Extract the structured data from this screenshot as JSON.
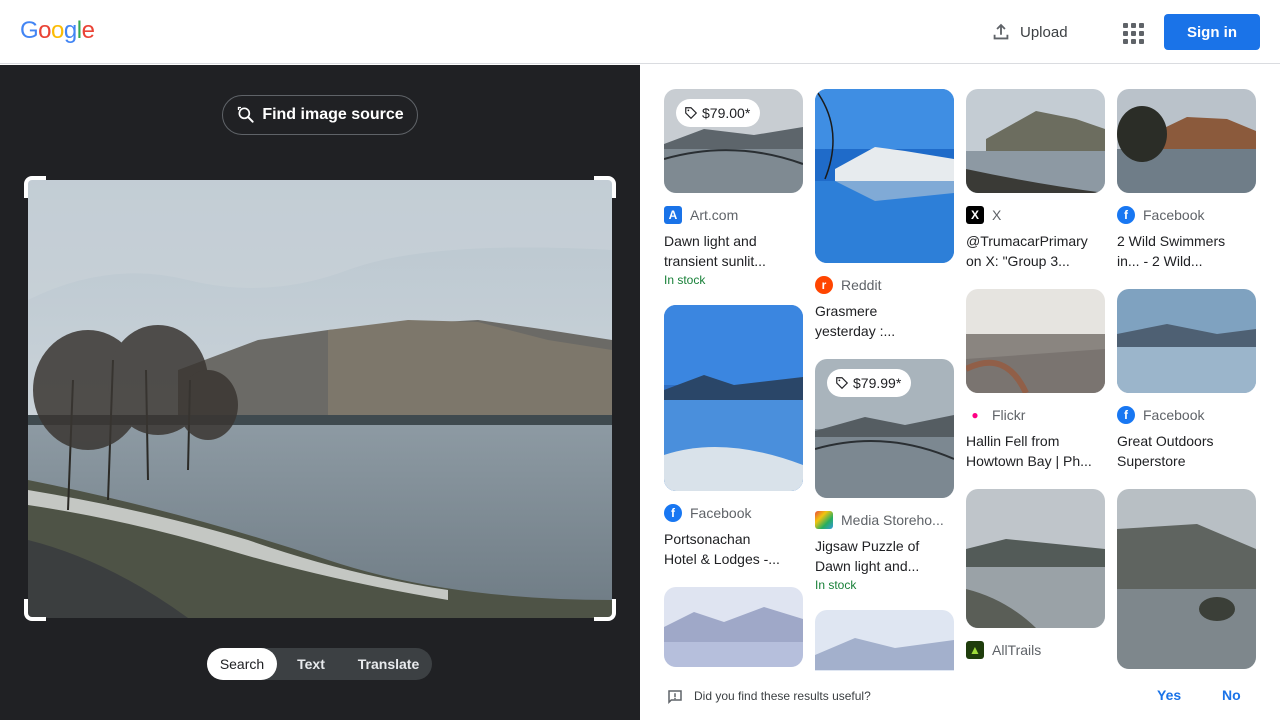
{
  "header": {
    "logo_letters": [
      "G",
      "o",
      "o",
      "g",
      "l",
      "e"
    ],
    "upload_label": "Upload",
    "sign_in_label": "Sign in"
  },
  "left": {
    "find_source_label": "Find image source",
    "modes": [
      "Search",
      "Text",
      "Translate"
    ],
    "selected_mode": "Search"
  },
  "results": [
    {
      "source": "Art.com",
      "title_line1": "Dawn light and",
      "title_line2": "transient sunlit...",
      "price": "$79.00*",
      "stock": "In stock",
      "favicon_icon": "art-com-icon",
      "favicon_color": "#1a73e8"
    },
    {
      "source": "Facebook",
      "title_line1": "Portsonachan",
      "title_line2": "Hotel & Lodges -...",
      "price": "",
      "stock": "",
      "favicon_icon": "facebook-icon",
      "favicon_color": "#1877f2"
    },
    {
      "source": "Reddit",
      "title_line1": "Grasmere",
      "title_line2": "yesterday :...",
      "price": "",
      "stock": "",
      "favicon_icon": "reddit-icon",
      "favicon_color": "#ff4500"
    },
    {
      "source": "Media Storeho...",
      "title_line1": "Jigsaw Puzzle of",
      "title_line2": "Dawn light and...",
      "price": "$79.99*",
      "stock": "In stock",
      "favicon_icon": "media-storehouse-icon",
      "favicon_color": "#8e44ad"
    },
    {
      "source": "X",
      "title_line1": "@TrumacarPrimary",
      "title_line2": "on X: \"Group 3...",
      "price": "",
      "stock": "",
      "favicon_icon": "x-icon",
      "favicon_color": "#000000"
    },
    {
      "source": "Flickr",
      "title_line1": "Hallin Fell from",
      "title_line2": "Howtown Bay | Ph...",
      "price": "",
      "stock": "",
      "favicon_icon": "flickr-icon",
      "favicon_color": "#ff0084"
    },
    {
      "source": "AllTrails",
      "title_line1": "",
      "title_line2": "",
      "price": "",
      "stock": "",
      "favicon_icon": "alltrails-icon",
      "favicon_color": "#1f3d0c"
    },
    {
      "source": "Facebook",
      "title_line1": "2 Wild Swimmers",
      "title_line2": "in... - 2 Wild...",
      "price": "",
      "stock": "",
      "favicon_icon": "facebook-icon",
      "favicon_color": "#1877f2"
    },
    {
      "source": "Facebook",
      "title_line1": "Great Outdoors",
      "title_line2": "Superstore",
      "price": "",
      "stock": "",
      "favicon_icon": "facebook-icon",
      "favicon_color": "#1877f2"
    }
  ],
  "feedback": {
    "question": "Did you find these results useful?",
    "yes_label": "Yes",
    "no_label": "No"
  },
  "colors": {
    "accent": "#1a73e8",
    "dark_panel": "#202124",
    "in_stock": "#188038"
  }
}
